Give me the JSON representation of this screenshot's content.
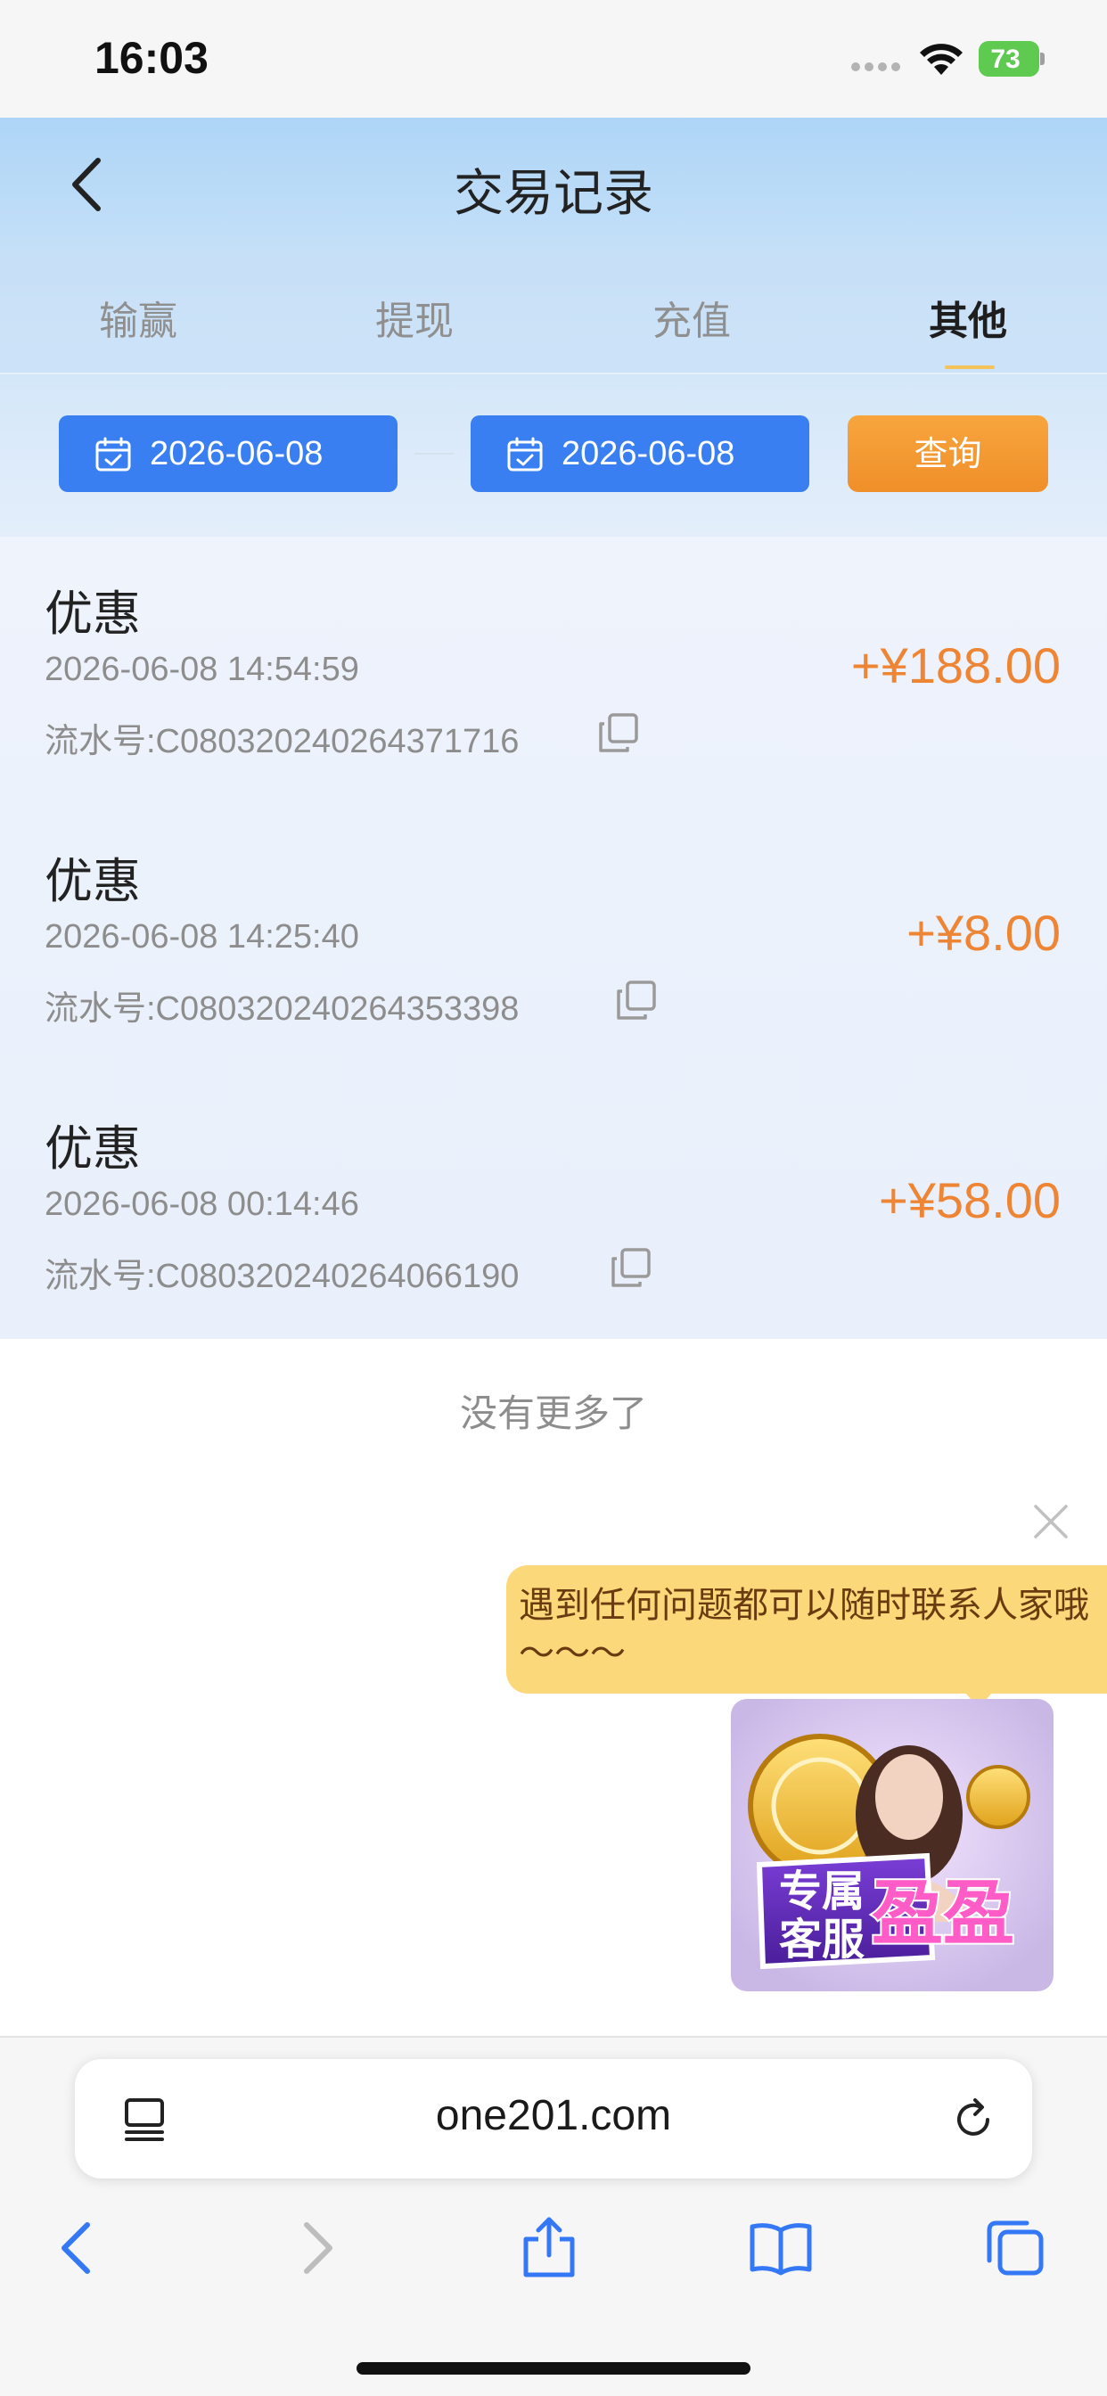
{
  "status_bar": {
    "time": "16:03",
    "battery": "73"
  },
  "header": {
    "title": "交易记录"
  },
  "tabs": [
    {
      "label": "输赢",
      "active": false
    },
    {
      "label": "提现",
      "active": false
    },
    {
      "label": "充值",
      "active": false
    },
    {
      "label": "其他",
      "active": true
    }
  ],
  "filter": {
    "start_date": "2026-06-08",
    "end_date": "2026-06-08",
    "query_label": "查询"
  },
  "records": [
    {
      "title": "优惠",
      "time": "2026-06-08 14:54:59",
      "serial": "流水号:C080320240264371716",
      "amount": "+¥188.00"
    },
    {
      "title": "优惠",
      "time": "2026-06-08 14:25:40",
      "serial": "流水号:C080320240264353398",
      "amount": "+¥8.00"
    },
    {
      "title": "优惠",
      "time": "2026-06-08 00:14:46",
      "serial": "流水号:C080320240264066190",
      "amount": "+¥58.00"
    }
  ],
  "no_more": "没有更多了",
  "support": {
    "bubble_text": "遇到任何问题都可以随时联系人家哦～～～",
    "badge_line1": "专属",
    "badge_line2": "客服",
    "agent_name": "盈盈"
  },
  "browser": {
    "url": "one201.com"
  },
  "colors": {
    "primary": "#3a7ff2",
    "accent": "#ee8534",
    "bubble": "#fbd879"
  },
  "icons": [
    "back-icon",
    "calendar-icon",
    "copy-icon",
    "close-icon",
    "tabs-list-icon",
    "reload-icon",
    "share-icon",
    "bookmarks-icon",
    "tabs-icon",
    "wifi-icon"
  ]
}
